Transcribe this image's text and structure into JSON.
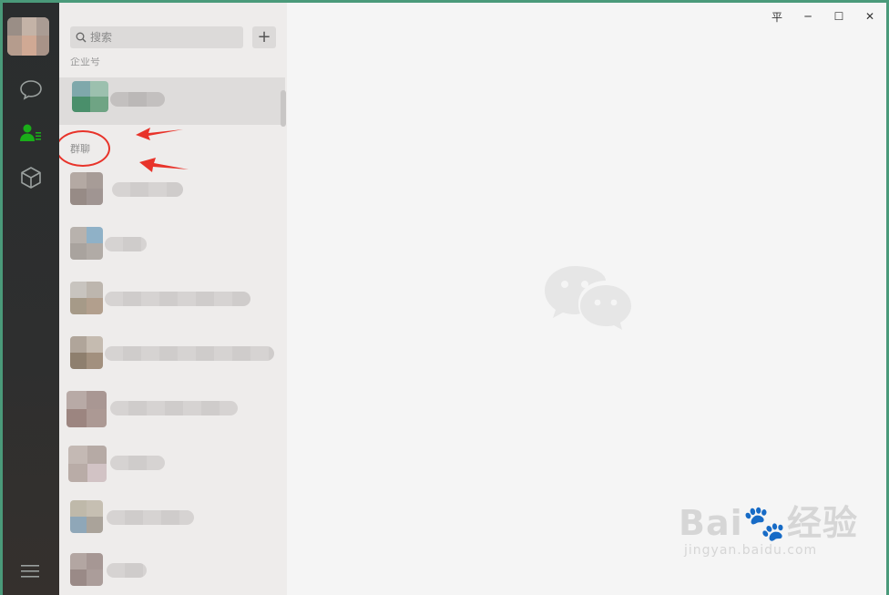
{
  "search": {
    "placeholder": "搜索"
  },
  "add_button": {
    "label": "+"
  },
  "sections": {
    "official": "企业号",
    "group_chat": "群聊"
  },
  "window_controls": {
    "pin": "平",
    "minimize": "─",
    "maximize": "☐",
    "close": "✕"
  },
  "watermark": {
    "brand": "Bai",
    "brand2": "经验",
    "url": "jingyan.baidu.com"
  },
  "colors": {
    "accent_green": "#1aad19",
    "annotation_red": "#e8332a"
  }
}
